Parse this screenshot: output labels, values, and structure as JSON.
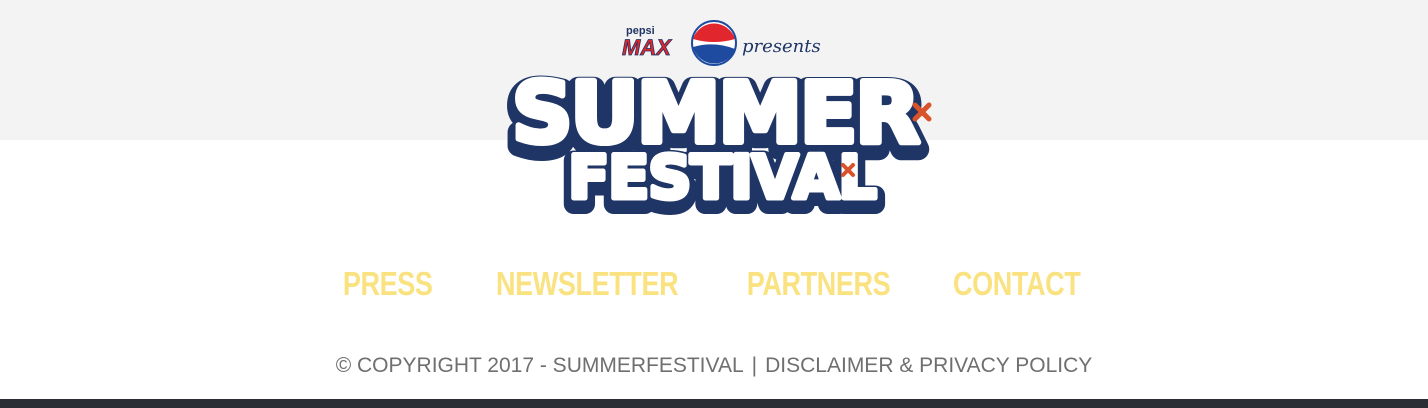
{
  "logo": {
    "sponsor_small": "pepsi",
    "sponsor_brand": "MAX",
    "presents": "presents",
    "title_line1": "SUMMER",
    "title_line2": "FESTIVAL",
    "colors": {
      "outline": "#1f3566",
      "fill": "#ffffff",
      "accent": "#d8532a",
      "pepsi_red": "#e1262d",
      "pepsi_blue": "#1e4aa0"
    }
  },
  "nav": {
    "items": [
      {
        "label": "PRESS"
      },
      {
        "label": "NEWSLETTER"
      },
      {
        "label": "PARTNERS"
      },
      {
        "label": "CONTACT"
      }
    ],
    "color": "#f9e27f"
  },
  "footer": {
    "copyright": "© COPYRIGHT 2017 - SUMMERFESTIVAL",
    "separator": "|",
    "policy_link": "DISCLAIMER & PRIVACY POLICY"
  }
}
